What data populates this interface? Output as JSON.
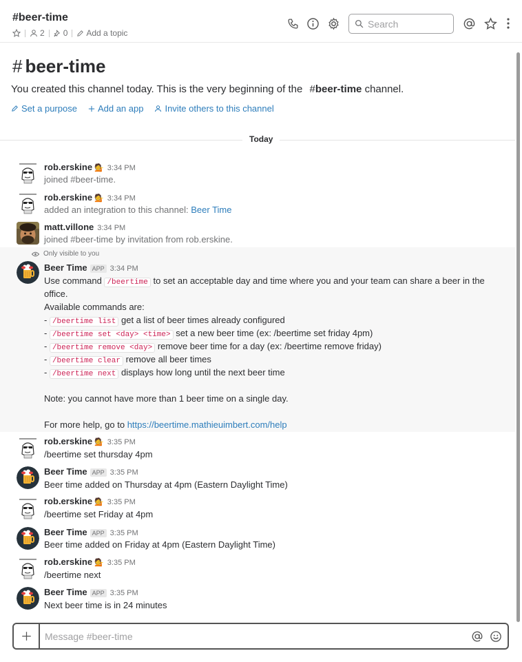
{
  "channel": {
    "name": "#beer-time",
    "members": "2",
    "pins": "0",
    "add_topic": "Add a topic"
  },
  "search": {
    "placeholder": "Search"
  },
  "intro": {
    "title": "beer-time",
    "hash": "#",
    "text_before": "You created this channel today. This is the very beginning of the",
    "text_channel": "beer-time",
    "text_after": "channel.",
    "actions": [
      "Set a purpose",
      "Add an app",
      "Invite others to this channel"
    ]
  },
  "divider": {
    "label": "Today"
  },
  "messages": [
    {
      "sender": "rob.erskine",
      "emoji": "💁",
      "time": "3:34 PM",
      "body": "joined #beer-time."
    },
    {
      "sender": "rob.erskine",
      "emoji": "💁",
      "time": "3:34 PM",
      "body_prefix": "added an integration to this channel:",
      "body_link": "Beer Time"
    },
    {
      "sender": "matt.villone",
      "time": "3:34 PM",
      "body": "joined #beer-time by invitation from rob.erskine."
    },
    {
      "ephemeral_label": "Only visible to you",
      "sender": "Beer Time",
      "badge": "APP",
      "time": "3:34 PM",
      "line1_a": "Use command",
      "line1_code": "/beertime",
      "line1_b": "to set an acceptable day and time where you and your team can share a beer in the",
      "line2": "office.",
      "line3": "Available commands are:",
      "commands": [
        {
          "code": "/beertime list",
          "desc": "get a list of beer times already configured"
        },
        {
          "code": "/beertime set <day> <time>",
          "desc": "set a new beer time (ex: /beertime set friday 4pm)"
        },
        {
          "code": "/beertime remove <day>",
          "desc": "remove beer time for a day (ex: /beertime remove friday)"
        },
        {
          "code": "/beertime clear",
          "desc": "remove all beer times"
        },
        {
          "code": "/beertime next",
          "desc": "displays how long until the next beer time"
        }
      ],
      "note": "Note: you cannot have more than 1 beer time on a single day.",
      "help_prefix": "For more help, go to",
      "help_link": "https://beertime.mathieuimbert.com/help"
    },
    {
      "sender": "rob.erskine",
      "emoji": "💁",
      "time": "3:35 PM",
      "body": "/beertime set thursday 4pm"
    },
    {
      "sender": "Beer Time",
      "badge": "APP",
      "time": "3:35 PM",
      "body": "Beer time added on Thursday at 4pm (Eastern Daylight Time)"
    },
    {
      "sender": "rob.erskine",
      "emoji": "💁",
      "time": "3:35 PM",
      "body": "/beertime set Friday at 4pm"
    },
    {
      "sender": "Beer Time",
      "badge": "APP",
      "time": "3:35 PM",
      "body": "Beer time added on Friday at 4pm (Eastern Daylight Time)"
    },
    {
      "sender": "rob.erskine",
      "emoji": "💁",
      "time": "3:35 PM",
      "body": "/beertime next"
    },
    {
      "sender": "Beer Time",
      "badge": "APP",
      "time": "3:35 PM",
      "body": "Next beer time is in 24 minutes"
    }
  ],
  "composer": {
    "placeholder": "Message #beer-time"
  },
  "colors": {
    "link": "#2d7dbb",
    "code": "#cc2255",
    "text": "#2c2d30",
    "muted": "#717274"
  }
}
